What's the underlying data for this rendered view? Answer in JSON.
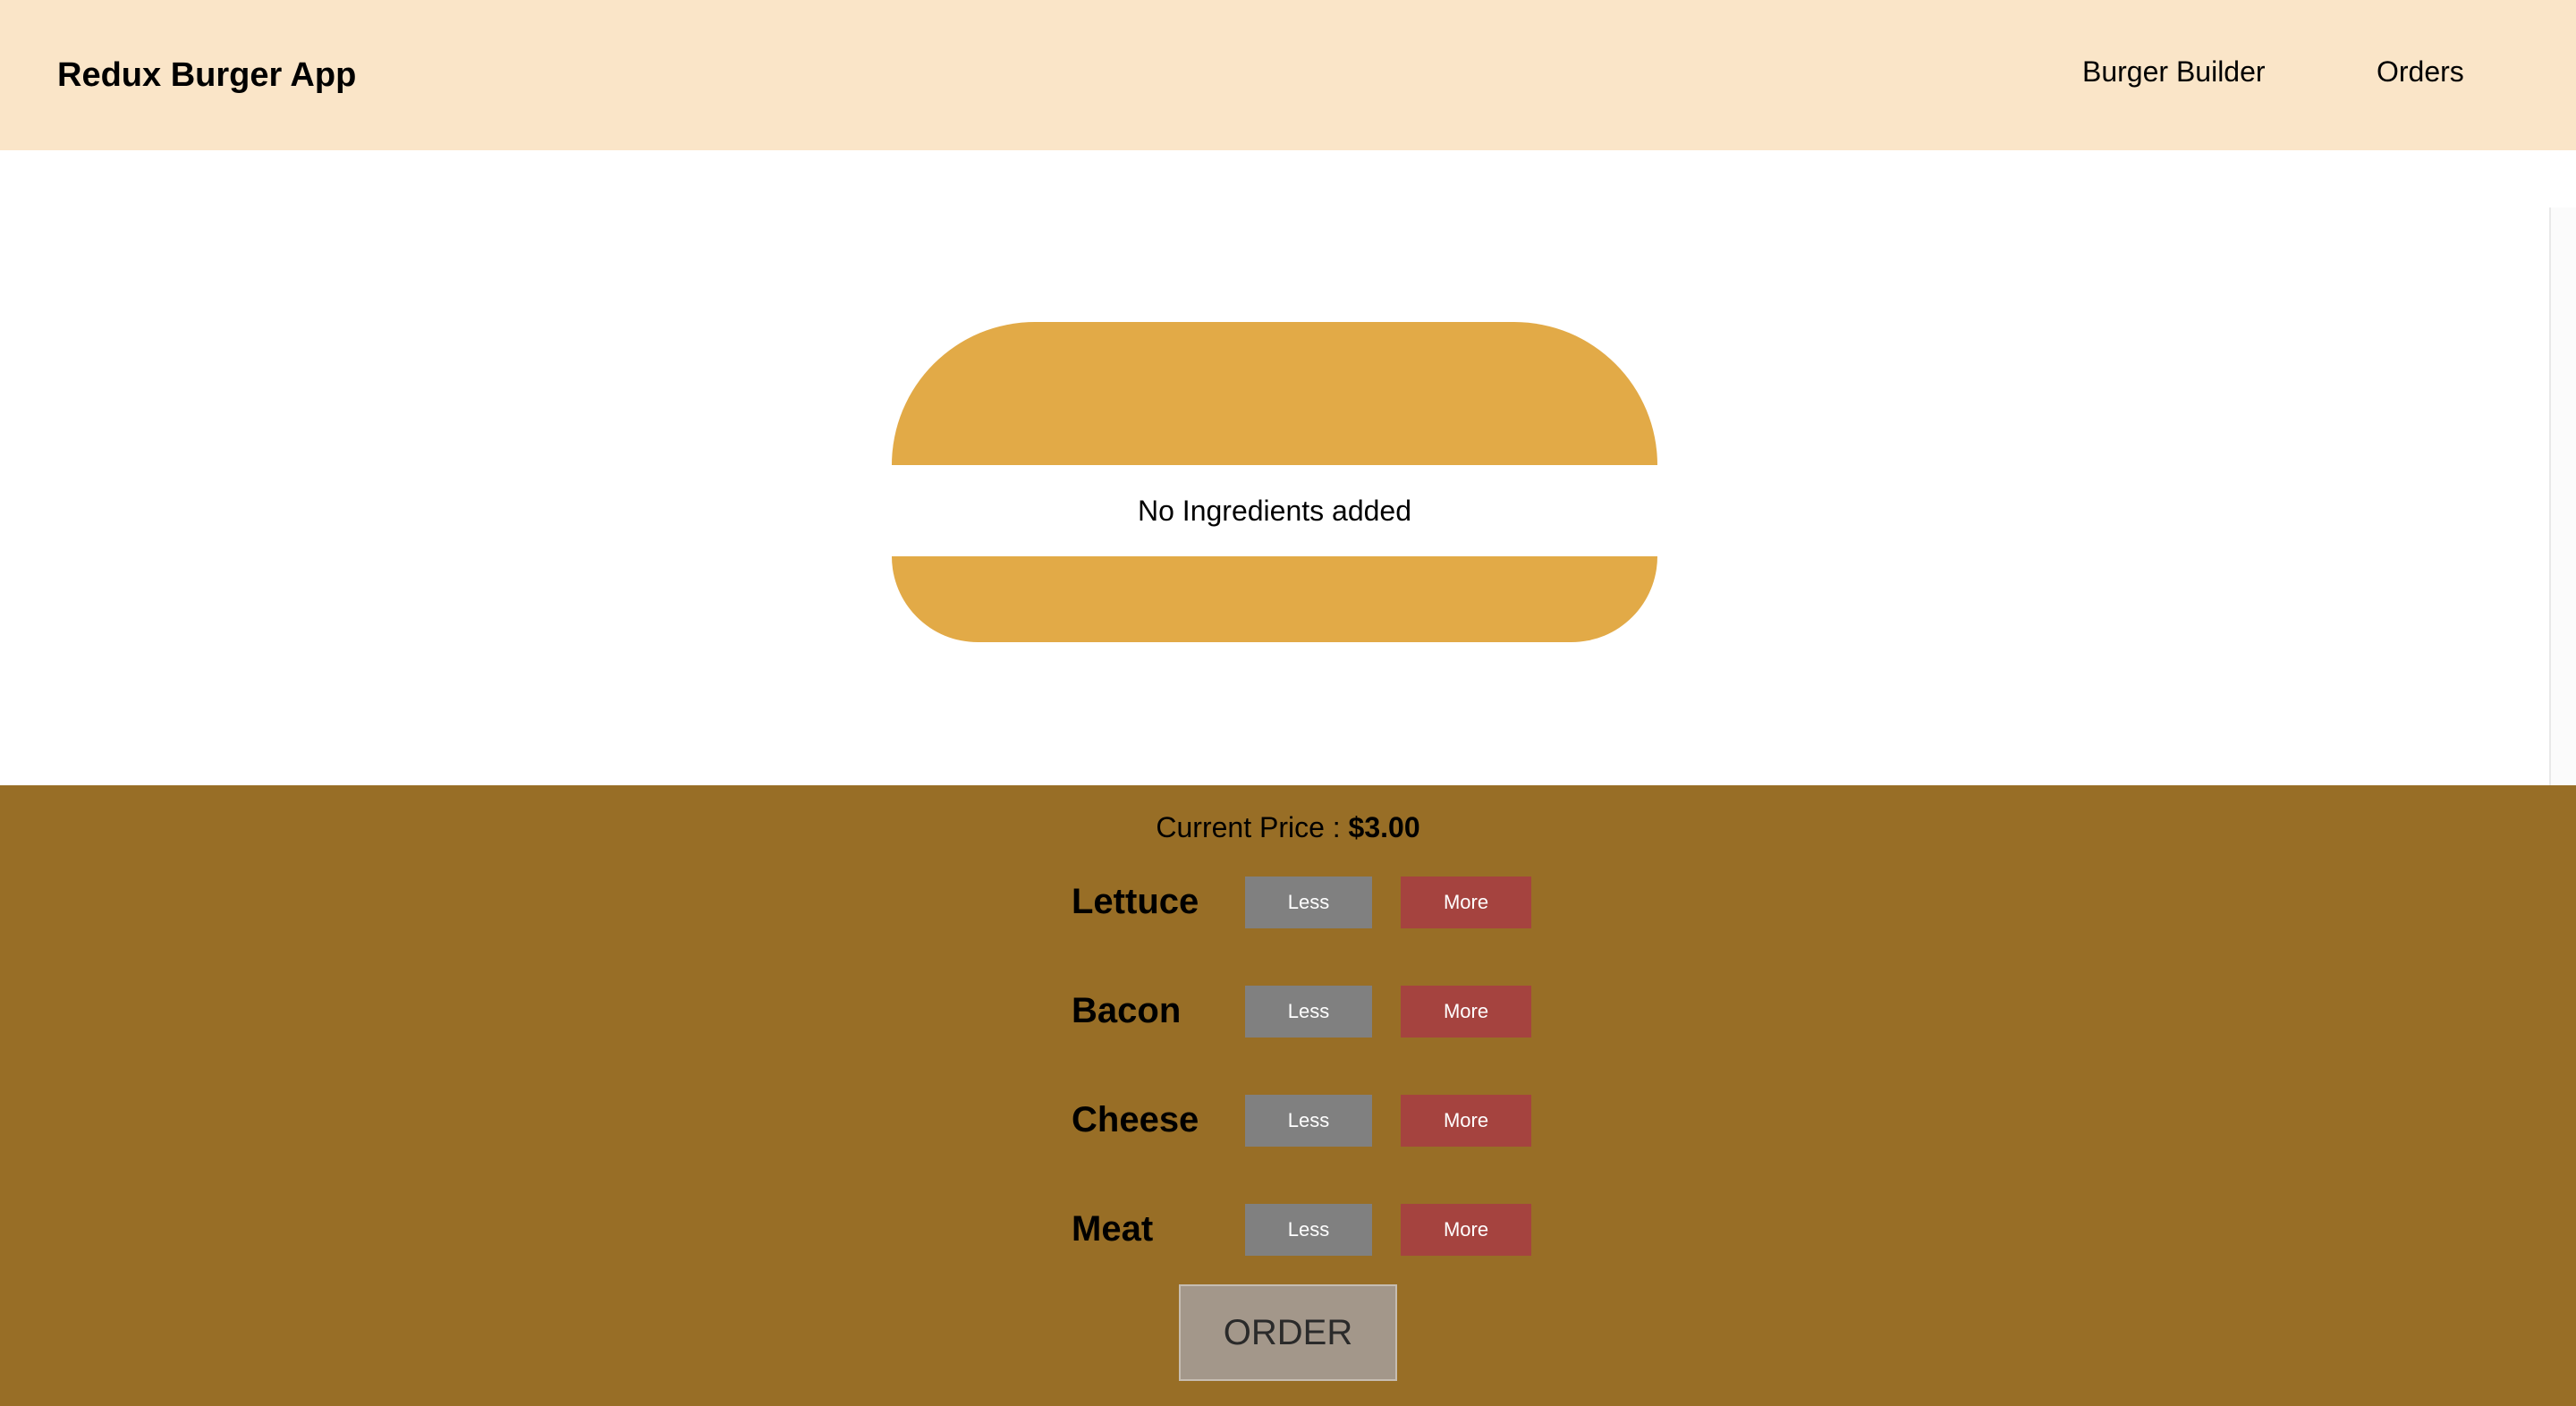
{
  "header": {
    "brand": "Redux Burger App",
    "nav": [
      "Burger Builder",
      "Orders"
    ]
  },
  "burger": {
    "empty_message": "No Ingredients added"
  },
  "controls": {
    "price_label": "Current Price :",
    "price_value": "$3.00",
    "ingredients": [
      {
        "label": "Lettuce",
        "less": "Less",
        "more": "More"
      },
      {
        "label": "Bacon",
        "less": "Less",
        "more": "More"
      },
      {
        "label": "Cheese",
        "less": "Less",
        "more": "More"
      },
      {
        "label": "Meat",
        "less": "Less",
        "more": "More"
      }
    ],
    "order_label": "ORDER"
  },
  "colors": {
    "header_bg": "#fae5c8",
    "bun": "#e2aa47",
    "controls_bg": "#986e26",
    "less_button": "#808080",
    "more_button": "#a5433f",
    "order_button_disabled": "#a3978a"
  }
}
